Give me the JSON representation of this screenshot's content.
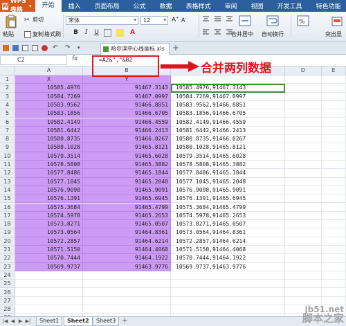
{
  "menubar": {
    "app_name": "WPS 表格",
    "items": [
      "开始",
      "插入",
      "页面布局",
      "公式",
      "数据",
      "表格样式",
      "审阅",
      "视图",
      "开发工具",
      "特色功能"
    ]
  },
  "ribbon": {
    "paste": "粘贴",
    "cut": "剪切",
    "copy": "复制",
    "format_painter": "格式刷",
    "font_name": "宋体",
    "font_size": "12",
    "merge_center": "合并居中",
    "wrap_text": "自动换行",
    "highlight": "突出显",
    "bold": "B",
    "italic": "I",
    "underline": "U",
    "grow_font": "A",
    "shrink_font": "A"
  },
  "tabbar": {
    "doc_tab": "哈尔滨中心线坐标.xls",
    "new_tab": "+"
  },
  "formulabar": {
    "name_box": "C2",
    "fx": "fx",
    "formula": "=A2&\",\"&B2"
  },
  "annotation": {
    "text": "合并两列数据"
  },
  "grid": {
    "columns": [
      "A",
      "B",
      "C",
      "D",
      "E"
    ],
    "rows": [
      {
        "n": "1",
        "a": "X",
        "b": "Y",
        "c": ""
      },
      {
        "n": "2",
        "a": "10585.4976",
        "b": "91467.3143",
        "c": "10585.4976,91467.3143"
      },
      {
        "n": "3",
        "a": "10584.7269",
        "b": "91467.0997",
        "c": "10584.7269,91467.0997"
      },
      {
        "n": "4",
        "a": "10583.9562",
        "b": "91466.8851",
        "c": "10583.9562,91466.8851"
      },
      {
        "n": "5",
        "a": "10583.1856",
        "b": "91466.6705",
        "c": "10583.1856,91466.6705"
      },
      {
        "n": "6",
        "a": "10582.4149",
        "b": "91466.4559",
        "c": "10582.4149,91466.4559"
      },
      {
        "n": "7",
        "a": "10581.6442",
        "b": "91466.2413",
        "c": "10581.6442,91466.2413"
      },
      {
        "n": "8",
        "a": "10580.8735",
        "b": "91466.0267",
        "c": "10580.8735,91466.0267"
      },
      {
        "n": "9",
        "a": "10580.1028",
        "b": "91465.8121",
        "c": "10580.1028,91465.8121"
      },
      {
        "n": "10",
        "a": "10579.3514",
        "b": "91465.6028",
        "c": "10579.3514,91465.6028"
      },
      {
        "n": "11",
        "a": "10578.5808",
        "b": "91465.3882",
        "c": "10578.5808,91465.3882"
      },
      {
        "n": "12",
        "a": "10577.8486",
        "b": "91465.1844",
        "c": "10577.8486,91465.1844"
      },
      {
        "n": "13",
        "a": "10577.1045",
        "b": "91465.2048",
        "c": "10577.1045,91465.2048"
      },
      {
        "n": "14",
        "a": "10576.9098",
        "b": "91465.9091",
        "c": "10576.9098,91465.9091"
      },
      {
        "n": "15",
        "a": "10576.1391",
        "b": "91465.6945",
        "c": "10576.1391,91465.6945"
      },
      {
        "n": "16",
        "a": "10575.3684",
        "b": "91465.4799",
        "c": "10575.3684,91465.4799"
      },
      {
        "n": "17",
        "a": "10574.5978",
        "b": "91465.2653",
        "c": "10574.5978,91465.2653"
      },
      {
        "n": "18",
        "a": "10573.8271",
        "b": "91465.0507",
        "c": "10573.8271,91465.0507"
      },
      {
        "n": "19",
        "a": "10573.0564",
        "b": "91464.8361",
        "c": "10573.0564,91464.8361"
      },
      {
        "n": "20",
        "a": "10572.2857",
        "b": "91464.6214",
        "c": "10572.2857,91464.6214"
      },
      {
        "n": "21",
        "a": "10571.5150",
        "b": "91464.4068",
        "c": "10571.5150,91464.4068"
      },
      {
        "n": "22",
        "a": "10570.7444",
        "b": "91464.1922",
        "c": "10570.7444,91464.1922"
      },
      {
        "n": "23",
        "a": "10569.9737",
        "b": "91463.9776",
        "c": "10569.9737,91463.9776"
      },
      {
        "n": "24",
        "a": "",
        "b": "",
        "c": ""
      },
      {
        "n": "25",
        "a": "",
        "b": "",
        "c": ""
      },
      {
        "n": "26",
        "a": "",
        "b": "",
        "c": ""
      },
      {
        "n": "27",
        "a": "",
        "b": "",
        "c": ""
      },
      {
        "n": "28",
        "a": "",
        "b": "",
        "c": ""
      },
      {
        "n": "29",
        "a": "",
        "b": "",
        "c": ""
      }
    ]
  },
  "sheets": {
    "tabs": [
      "Sheet1",
      "Sheet2",
      "Sheet3"
    ],
    "active": "Sheet2",
    "add": "+"
  },
  "watermark": {
    "line1": "jb51.net",
    "line2": "脚本之家"
  },
  "colors": {
    "menubar_bg": "#2b5f9e",
    "selection_fill": "#cc9bf5",
    "annotation_red": "#e0141e",
    "active_cell_border": "#3a8a3a"
  }
}
